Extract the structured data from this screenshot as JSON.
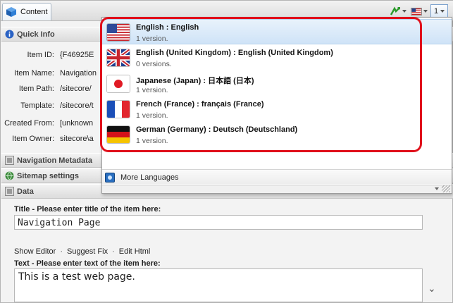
{
  "tab": {
    "label": "Content"
  },
  "toolbar": {
    "version_label": "1"
  },
  "sections": {
    "quick_info": "Quick Info",
    "navigation_metadata": "Navigation Metadata",
    "sitemap_settings": "Sitemap settings",
    "data": "Data"
  },
  "quick_info": {
    "rows": [
      {
        "label": "Item ID:",
        "value": "{F46925E"
      },
      {
        "label": "Item Name:",
        "value": "Navigation"
      },
      {
        "label": "Item Path:",
        "value": "/sitecore/"
      },
      {
        "label": "Template:",
        "value": "/sitecore/t"
      },
      {
        "label": "Created From:",
        "value": "[unknown"
      },
      {
        "label": "Item Owner:",
        "value": "sitecore\\a"
      }
    ]
  },
  "languages": [
    {
      "name": "English : English",
      "versions": "1 version.",
      "flag": "us-flag"
    },
    {
      "name": "English (United Kingdom) : English (United Kingdom)",
      "versions": "0 versions.",
      "flag": "uk-flag"
    },
    {
      "name": "Japanese (Japan) : 日本語 (日本)",
      "versions": "1 version.",
      "flag": "japan-flag"
    },
    {
      "name": "French (France) : français (France)",
      "versions": "1 version.",
      "flag": "france-flag"
    },
    {
      "name": "German (Germany) : Deutsch (Deutschland)",
      "versions": "1 version.",
      "flag": "germany-flag"
    }
  ],
  "more_languages": "More Languages",
  "data": {
    "title_label": "Title - Please enter title of the item here:",
    "title_value": "Navigation Page",
    "editor_links": [
      "Show Editor",
      "Suggest Fix",
      "Edit Html"
    ],
    "text_label": "Text - Please enter text of the item here:",
    "text_value": "This is a test web page."
  },
  "colors": {
    "highlight": "#e0101b",
    "selected_row": "#cfe3f7"
  }
}
